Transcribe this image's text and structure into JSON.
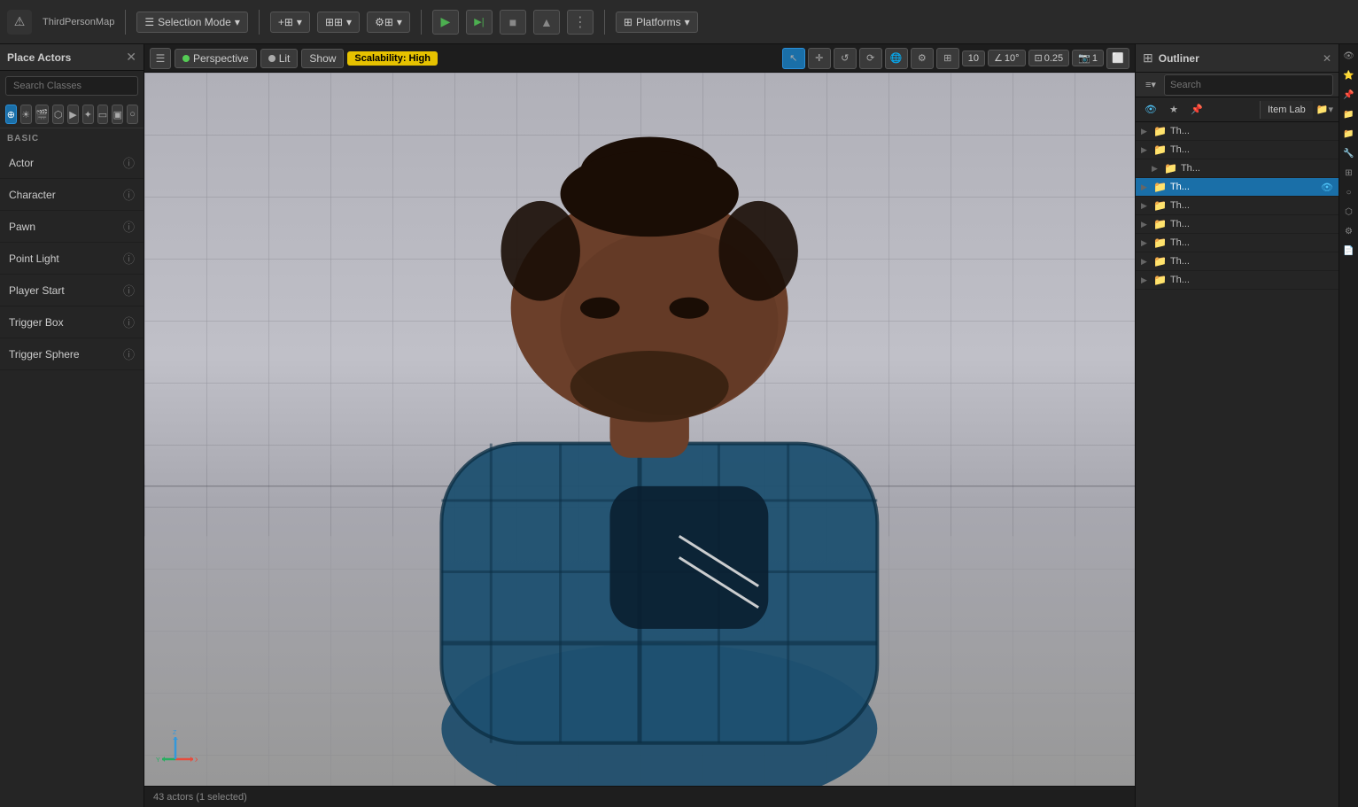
{
  "window": {
    "title": "ThirdPersonMap"
  },
  "top_toolbar": {
    "title": "ThirdPersonMap",
    "logo_icon": "⚠",
    "selection_mode_label": "Selection Mode",
    "platforms_label": "Platforms",
    "play_tooltip": "Play",
    "advance_frame_tooltip": "Advance Frame",
    "stop_tooltip": "Stop",
    "eject_tooltip": "Eject"
  },
  "place_actors_panel": {
    "title": "Place Actors",
    "search_placeholder": "Search Classes",
    "section_label": "BASIC",
    "actors": [
      {
        "name": "Actor",
        "id": "actor"
      },
      {
        "name": "Character",
        "id": "character"
      },
      {
        "name": "Pawn",
        "id": "pawn"
      },
      {
        "name": "Point Light",
        "id": "point-light"
      },
      {
        "name": "Player Start",
        "id": "player-start"
      },
      {
        "name": "Trigger Box",
        "id": "trigger-box"
      },
      {
        "name": "Trigger Sphere",
        "id": "trigger-sphere"
      }
    ]
  },
  "viewport": {
    "menu_icon": "☰",
    "perspective_label": "Perspective",
    "lit_label": "Lit",
    "show_label": "Show",
    "scalability_label": "Scalability: High",
    "grid_size": "10",
    "angle_snap": "10°",
    "scale_snap": "0.25",
    "camera_speed": "1",
    "tool_icons": [
      "↖",
      "✛",
      "↺",
      "⟳",
      "🌐",
      "⚙"
    ]
  },
  "outliner": {
    "title": "Outliner",
    "search_placeholder": "Search",
    "item_lab_label": "Item Lab",
    "tree_items": [
      {
        "name": "Th...",
        "type": "folder",
        "depth": 0
      },
      {
        "name": "Th...",
        "type": "folder",
        "depth": 0
      },
      {
        "name": "Th...",
        "type": "item",
        "depth": 1
      },
      {
        "name": "Th...",
        "type": "folder",
        "depth": 0,
        "selected": true
      },
      {
        "name": "Th...",
        "type": "folder",
        "depth": 0
      },
      {
        "name": "Th...",
        "type": "folder",
        "depth": 0
      },
      {
        "name": "Th...",
        "type": "folder",
        "depth": 0
      },
      {
        "name": "Th...",
        "type": "folder",
        "depth": 0
      },
      {
        "name": "Th...",
        "type": "folder",
        "depth": 0
      }
    ]
  },
  "status_bar": {
    "text": "43 actors (1 selected)"
  },
  "colors": {
    "accent_blue": "#1a6fa8",
    "accent_yellow": "#e6c200",
    "folder_gold": "#c8a84b",
    "selected_highlight": "#1a6fa8"
  }
}
